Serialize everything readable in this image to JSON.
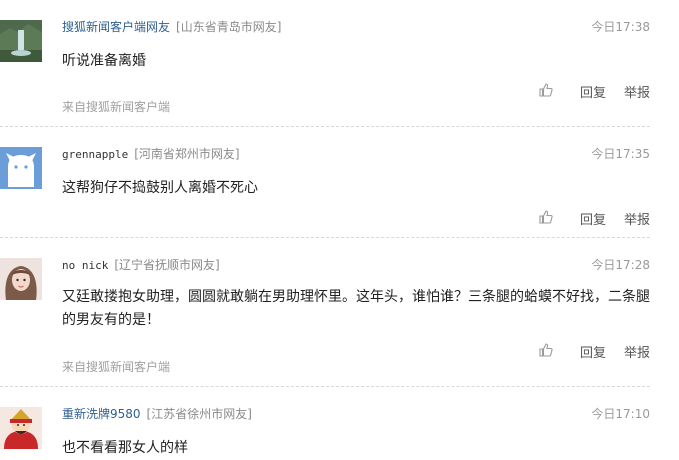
{
  "comments": [
    {
      "user": "搜狐新闻客户端网友",
      "location": "[山东省青岛市网友]",
      "time": "今日17:38",
      "text": "听说准备离婚",
      "source": "来自搜狐新闻客户端",
      "reply_label": "回复",
      "report_label": "举报"
    },
    {
      "user": "grennapple",
      "location": "[河南省郑州市网友]",
      "time": "今日17:35",
      "text": "这帮狗仔不捣鼓别人离婚不死心",
      "source": "",
      "reply_label": "回复",
      "report_label": "举报"
    },
    {
      "user": "no nick",
      "location": "[辽宁省抚顺市网友]",
      "time": "今日17:28",
      "text": "又廷敢搂抱女助理，圆圆就敢躺在男助理怀里。这年头，谁怕谁？三条腿的蛤蟆不好找，二条腿的男友有的是！",
      "source": "来自搜狐新闻客户端",
      "reply_label": "回复",
      "report_label": "举报"
    },
    {
      "user": "重新洗牌9580",
      "location": "[江苏省徐州市网友]",
      "time": "今日17:10",
      "text": "也不看看那女人的样",
      "source": "",
      "reply_label": "",
      "report_label": ""
    }
  ],
  "icons": {
    "like": "thumbs-up-icon"
  }
}
